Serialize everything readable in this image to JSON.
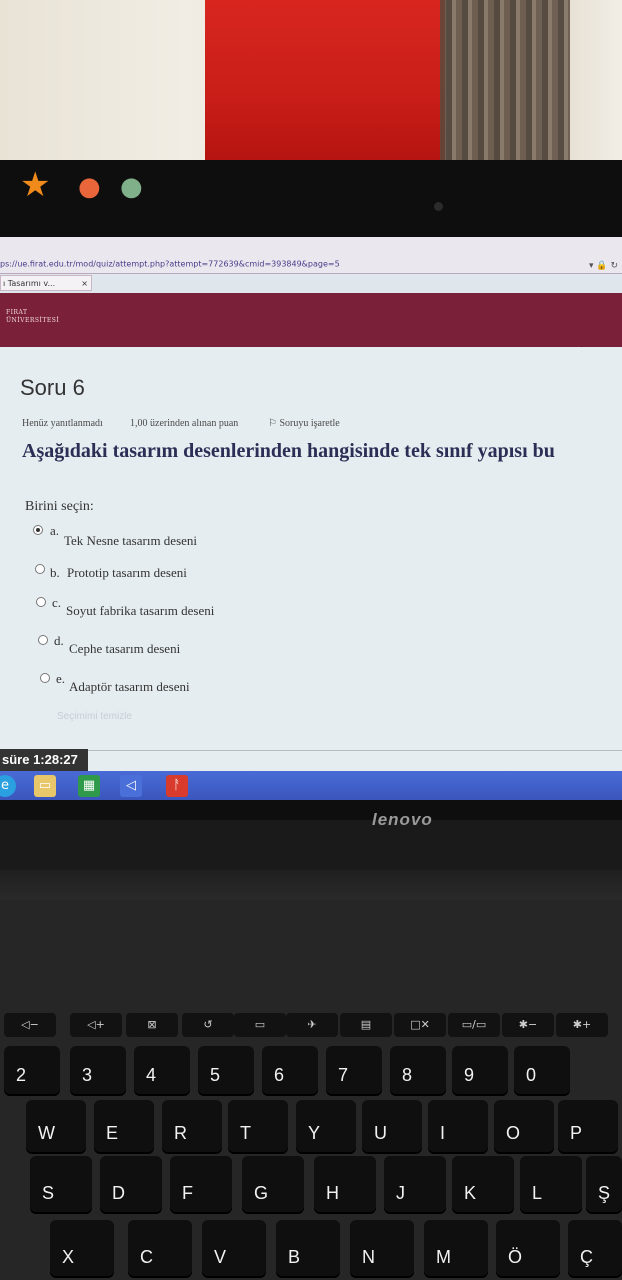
{
  "browser": {
    "url": "ps://ue.firat.edu.tr/mod/quiz/attempt.php?attempt=772639&cmid=393849&page=5",
    "tab_label": "ı Tasarımı v...",
    "tab_close": "×"
  },
  "site": {
    "logo_line1": "FIRAT",
    "logo_line2": "ÜNİVERSİTESİ"
  },
  "quiz": {
    "question_title": "Soru 6",
    "status": "Henüz yanıtlanmadı",
    "points": "1,00 üzerinden alınan puan",
    "flag_label": "Soruyu işaretle",
    "question_text": "Aşağıdaki tasarım desenlerinden hangisinde tek sınıf yapısı bu",
    "prompt": "Birini seçin:",
    "options": [
      {
        "letter": "a.",
        "text": "Tek Nesne tasarım deseni",
        "selected": true
      },
      {
        "letter": "b.",
        "text": "Prototip tasarım deseni",
        "selected": false
      },
      {
        "letter": "c.",
        "text": "Soyut fabrika tasarım deseni",
        "selected": false
      },
      {
        "letter": "d.",
        "text": "Cephe tasarım deseni",
        "selected": false
      },
      {
        "letter": "e.",
        "text": "Adaptör tasarım deseni",
        "selected": false
      }
    ],
    "clear_choice": "Seçimimi temizle",
    "timer": "süre 1:28:27"
  },
  "laptop": {
    "brand": "lenovo"
  },
  "keyboard": {
    "row_num": [
      "2",
      "3",
      "4",
      "5",
      "6",
      "7",
      "8",
      "9",
      "0"
    ],
    "row_q": [
      "W",
      "E",
      "R",
      "T",
      "Y",
      "U",
      "I",
      "O",
      "P"
    ],
    "row_a": [
      "S",
      "D",
      "F",
      "G",
      "H",
      "J",
      "K",
      "L",
      "Ş"
    ],
    "row_z": [
      "X",
      "C",
      "V",
      "B",
      "N",
      "M",
      "Ö",
      "Ç"
    ]
  },
  "colors": {
    "banner": "#7a2038",
    "question_text": "#2b2f55",
    "taskbar": "#3a56bd"
  }
}
